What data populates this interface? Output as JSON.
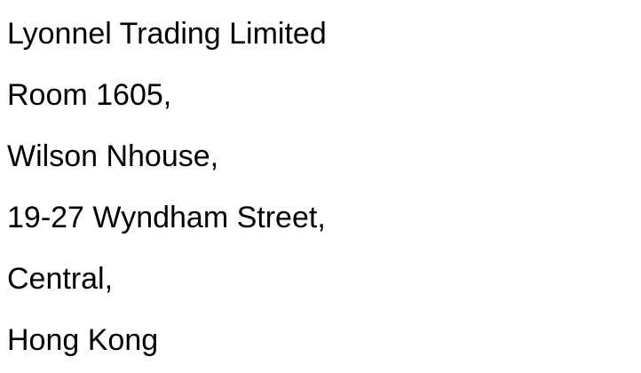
{
  "address": {
    "company": "Lyonnel Trading Limited",
    "room": "Room 1605,",
    "building": "Wilson Nhouse,",
    "street": "19-27 Wyndham Street,",
    "district": "Central,",
    "region": "Hong Kong"
  },
  "colors": {
    "background": "#ffffff",
    "text": "#000000"
  }
}
